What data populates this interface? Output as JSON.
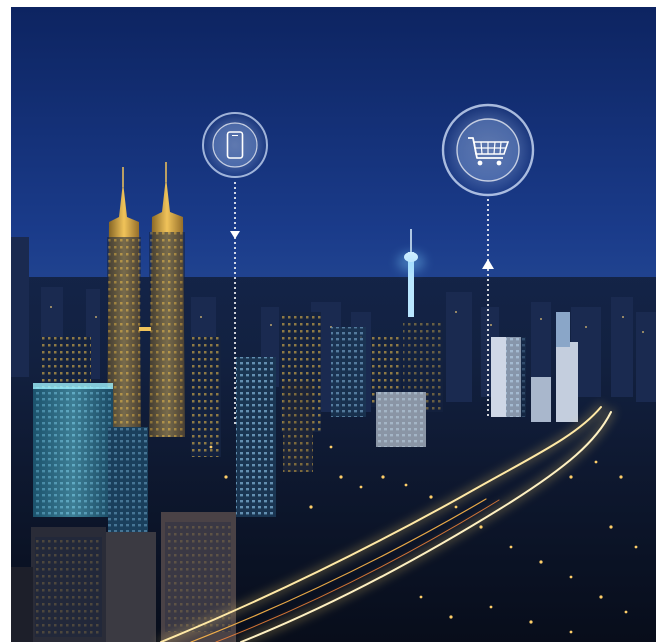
{
  "scene": {
    "description_icons": [
      "phone-icon",
      "shopping-cart-icon"
    ],
    "colors": {
      "sky_top": "#0f2a6b",
      "sky_mid": "#1d3f8e",
      "sky_low": "#30549b",
      "city_dark": "#0a1428",
      "window_gold": "#f2c24a",
      "highway_glow": "#ffd86a",
      "icon_ring": "#cfe3ff",
      "tower_cyan": "#7fd0ff"
    }
  }
}
